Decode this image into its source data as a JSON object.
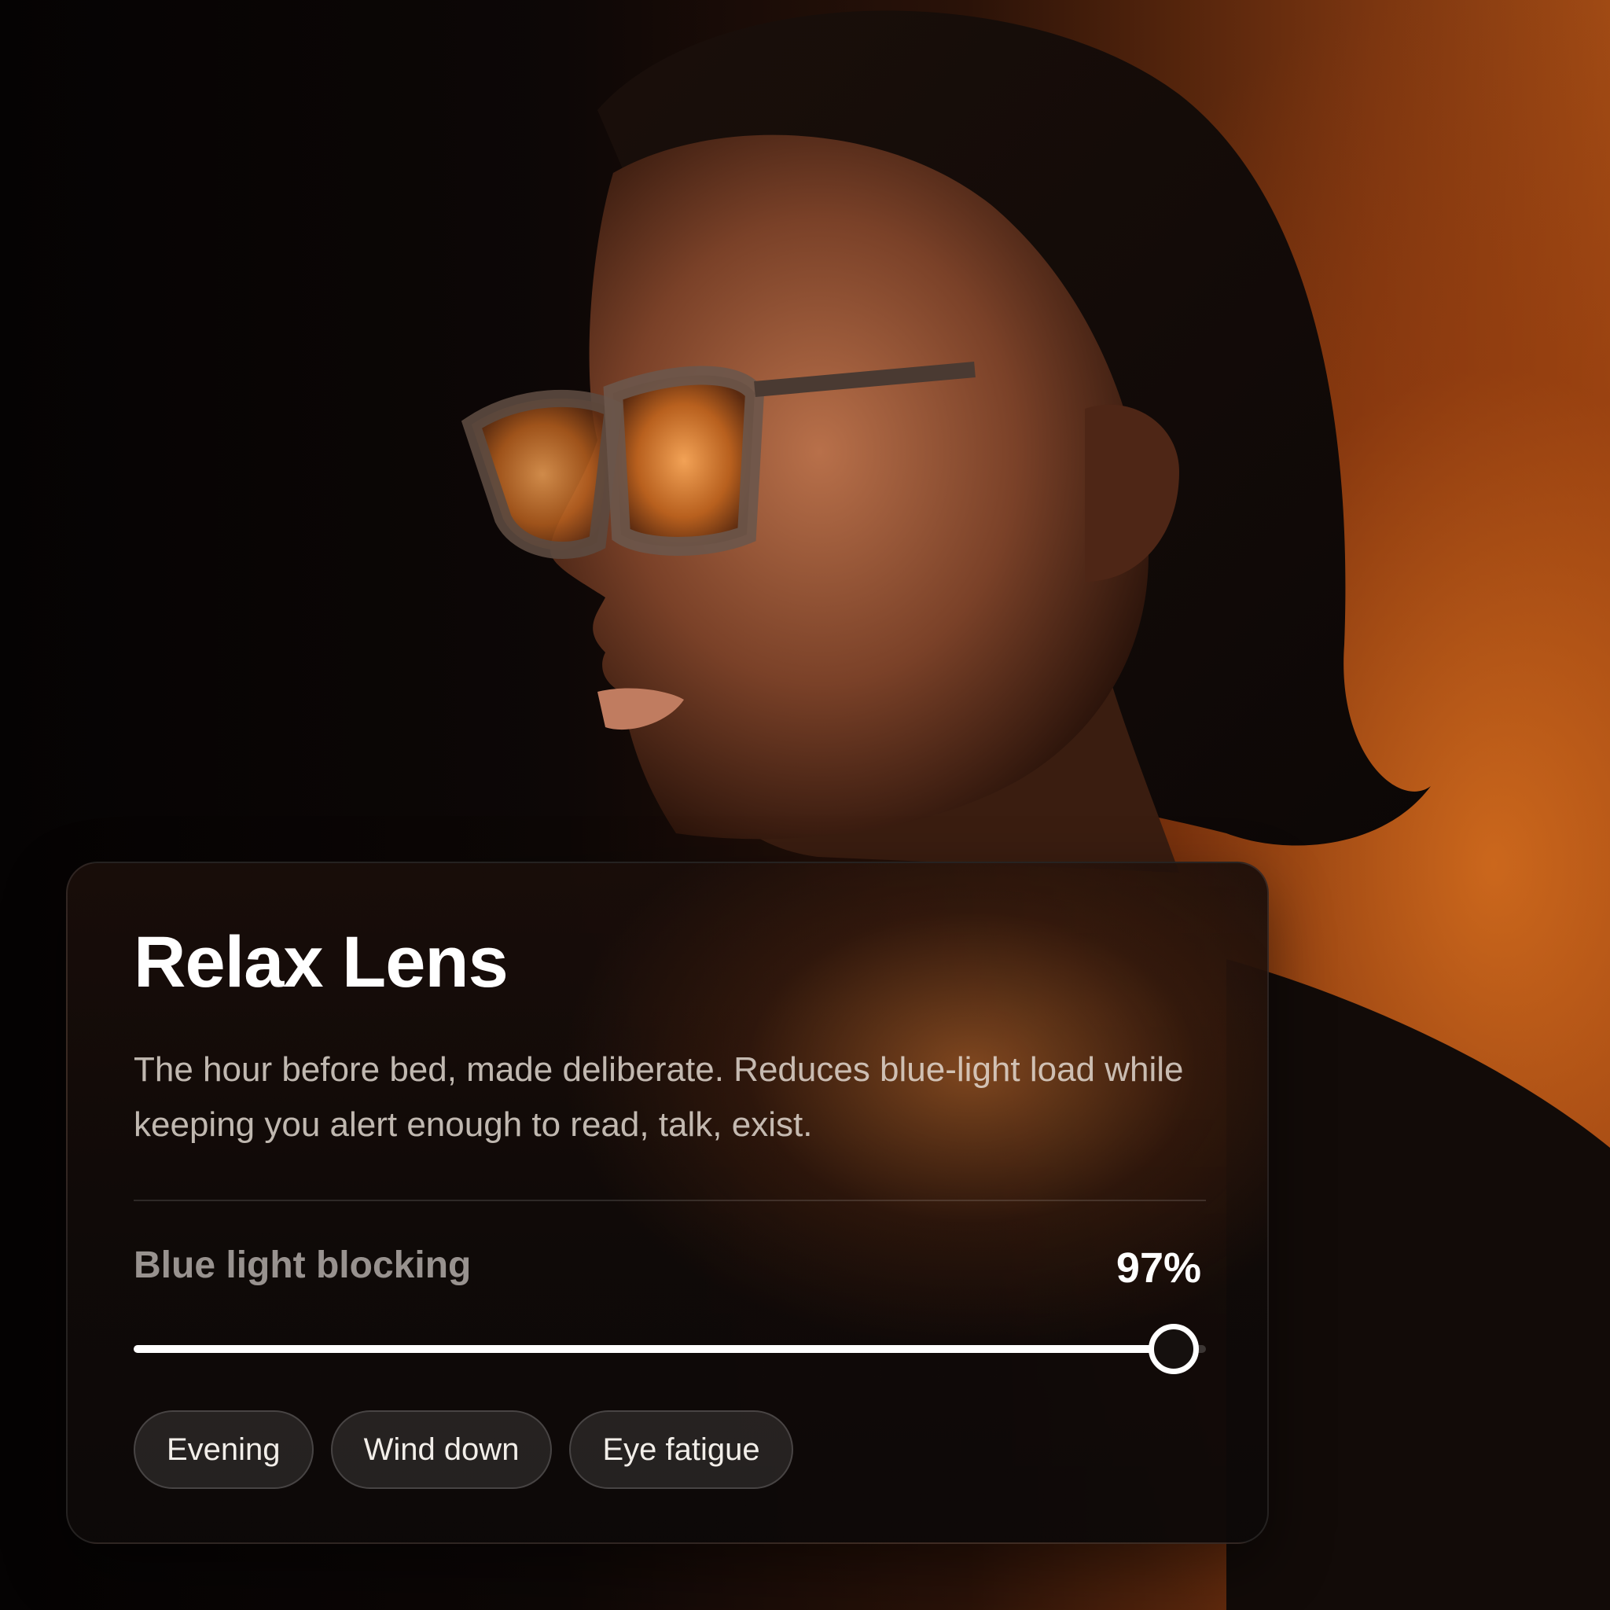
{
  "card": {
    "title": "Relax Lens",
    "description": "The hour before bed, made deliberate. Reduces blue-light load while keeping you alert enough to read, talk, exist.",
    "metric": {
      "label": "Blue light blocking",
      "value_text": "97%",
      "value": 0.97
    },
    "tags": [
      {
        "label": "Evening"
      },
      {
        "label": "Wind down"
      },
      {
        "label": "Eye fatigue"
      }
    ]
  },
  "colors": {
    "accent_orange": "#c8641e",
    "card_bg": "#120c0a",
    "text_primary": "#ffffff"
  }
}
